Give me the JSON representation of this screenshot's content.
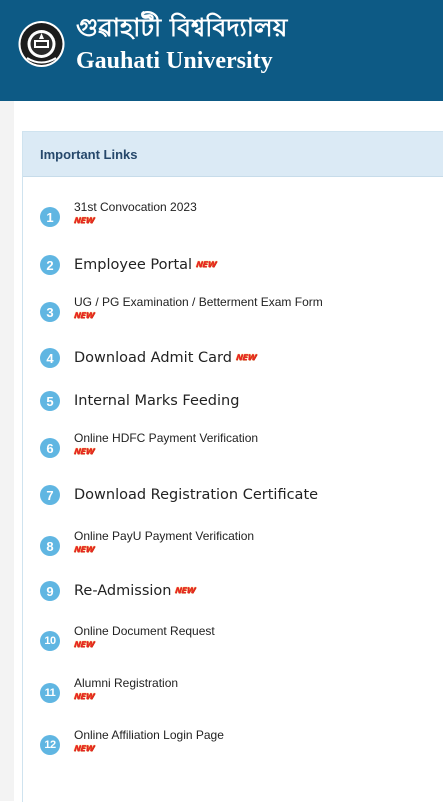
{
  "header": {
    "title_bengali": "গুৱাহাটী বিশ্ববিদ্যালয়",
    "title_english": "Gauhati University",
    "logo_icon": "university-seal-icon",
    "bg_color": "#0d5a85"
  },
  "panel": {
    "heading": "Important Links",
    "new_badge": "NEW",
    "items": [
      {
        "number": "1",
        "label": "31st Convocation 2023",
        "style": "small",
        "new": true
      },
      {
        "number": "2",
        "label": "Employee Portal",
        "style": "big",
        "new": true
      },
      {
        "number": "3",
        "label": "UG / PG Examination / Betterment Exam Form",
        "style": "small",
        "new": true
      },
      {
        "number": "4",
        "label": "Download Admit Card",
        "style": "big",
        "new": true
      },
      {
        "number": "5",
        "label": "Internal Marks Feeding",
        "style": "big",
        "new": false
      },
      {
        "number": "6",
        "label": "Online HDFC Payment Verification",
        "style": "small",
        "new": true
      },
      {
        "number": "7",
        "label": "Download Registration Certificate",
        "style": "big",
        "new": false
      },
      {
        "number": "8",
        "label": "Online PayU Payment Verification",
        "style": "small",
        "new": true
      },
      {
        "number": "9",
        "label": "Re-Admission",
        "style": "big",
        "new": true
      },
      {
        "number": "10",
        "label": "Online Document Request",
        "style": "small",
        "new": true
      },
      {
        "number": "11",
        "label": "Alumni Registration",
        "style": "small",
        "new": true
      },
      {
        "number": "12",
        "label": "Online Affiliation Login Page",
        "style": "small",
        "new": true
      }
    ]
  }
}
